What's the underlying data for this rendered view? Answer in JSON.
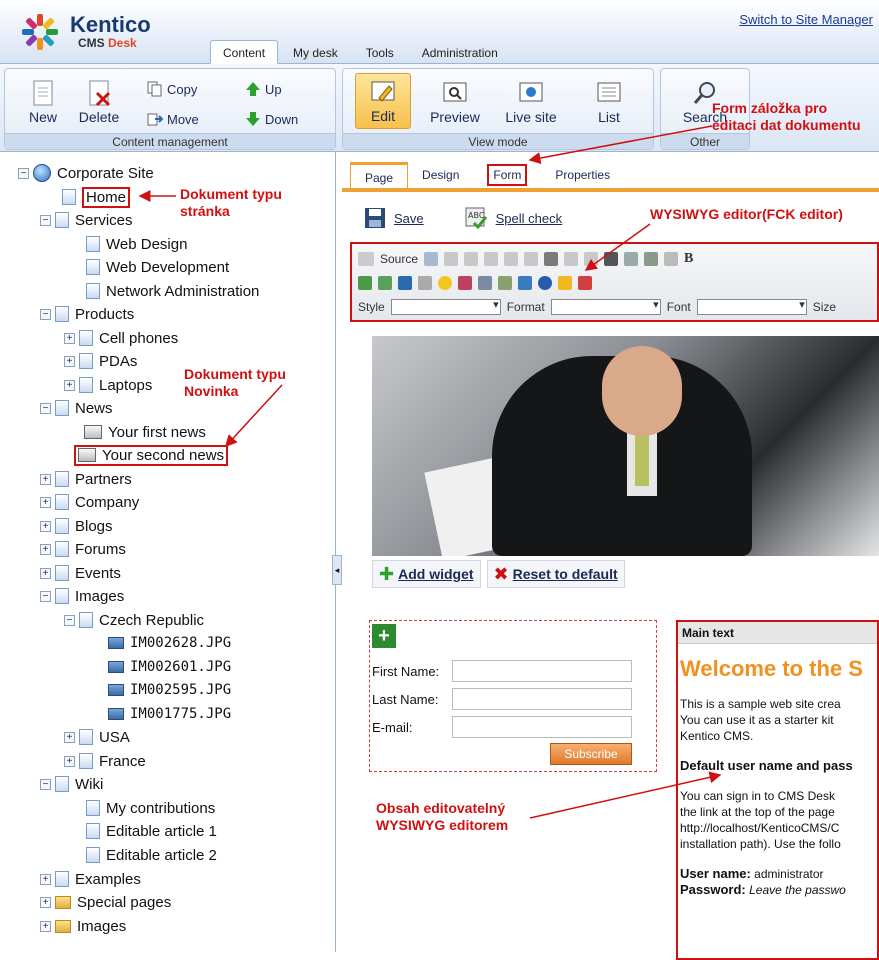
{
  "header": {
    "brand": "Kentico",
    "product_prefix": "CMS",
    "product_suffix": "Desk",
    "switch_link": "Switch to Site Manager",
    "tabs": [
      "Content",
      "My desk",
      "Tools",
      "Administration"
    ]
  },
  "ribbon": {
    "content_management": {
      "label": "Content management",
      "new": "New",
      "delete": "Delete",
      "copy": "Copy",
      "move": "Move",
      "up": "Up",
      "down": "Down"
    },
    "view_mode": {
      "label": "View mode",
      "edit": "Edit",
      "preview": "Preview",
      "live_site": "Live site",
      "list": "List"
    },
    "other": {
      "label": "Other",
      "search": "Search"
    }
  },
  "tree": {
    "root": "Corporate Site",
    "items": [
      "Home",
      "Services",
      "Web Design",
      "Web Development",
      "Network Administration",
      "Products",
      "Cell phones",
      "PDAs",
      "Laptops",
      "News",
      "Your first news",
      "Your second news",
      "Partners",
      "Company",
      "Blogs",
      "Forums",
      "Events",
      "Images",
      "Czech Republic",
      "IM002628.JPG",
      "IM002601.JPG",
      "IM002595.JPG",
      "IM001775.JPG",
      "USA",
      "France",
      "Wiki",
      "My contributions",
      "Editable article 1",
      "Editable article 2",
      "Examples",
      "Special pages",
      "Images"
    ]
  },
  "annotations": {
    "page_doc_1": "Dokument typu",
    "page_doc_2": "stránka",
    "news_doc_1": "Dokument typu",
    "news_doc_2": "Novinka",
    "form_tab_1": "Form záložka pro",
    "form_tab_2": "editaci dat dokumentu",
    "wysiwyg": "WYSIWYG editor(FCK editor)",
    "editable_1": "Obsah editovatelný",
    "editable_2": "WYSIWYG editorem"
  },
  "editor": {
    "subtabs": [
      "Page",
      "Design",
      "Form",
      "Properties"
    ],
    "save": "Save",
    "spell_check": "Spell check",
    "fck_source": "Source",
    "fck_style": "Style",
    "fck_format": "Format",
    "fck_font": "Font",
    "fck_size": "Size",
    "add_widget": "Add widget",
    "reset_default": "Reset to default"
  },
  "form": {
    "first_name": "First Name:",
    "last_name": "Last Name:",
    "email": "E-mail:",
    "subscribe": "Subscribe"
  },
  "main_text": {
    "header": "Main text",
    "title": "Welcome to the S",
    "p1_l1": "This is a sample web site crea",
    "p1_l2": "You can use it as a starter kit",
    "p1_l3": "Kentico CMS.",
    "h2": "Default user name and pass",
    "p2_l1": "You can sign in to CMS Desk",
    "p2_l2": "the link at the top of the page",
    "p2_l3": "http://localhost/KenticoCMS/C",
    "p2_l4": "installation path). Use the follo",
    "user_label": "User name:",
    "user_value": "administrator",
    "pass_label": "Password:",
    "pass_value": "Leave the passwo"
  },
  "colors": {
    "annotation": "#d01010",
    "accent": "#f0a030",
    "brand": "#1a3a6e"
  }
}
